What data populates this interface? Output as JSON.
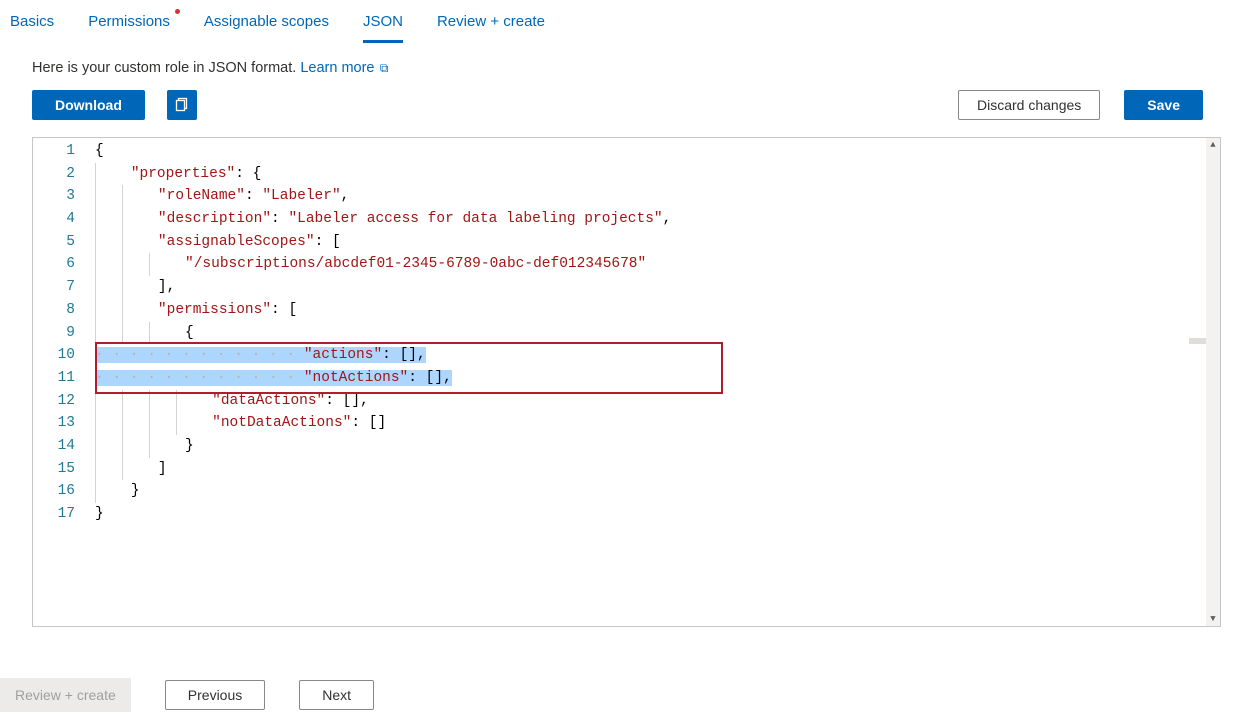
{
  "tabs": {
    "basics": "Basics",
    "permissions": "Permissions",
    "assignable_scopes": "Assignable scopes",
    "json": "JSON",
    "review_create": "Review + create"
  },
  "description": {
    "text": "Here is your custom role in JSON format. ",
    "link": "Learn more"
  },
  "actions": {
    "download": "Download",
    "discard": "Discard changes",
    "save": "Save"
  },
  "code": {
    "roleName_key": "\"roleName\"",
    "roleName_val": "\"Labeler\"",
    "description_key": "\"description\"",
    "description_val": "\"Labeler access for data labeling projects\"",
    "assignableScopes_key": "\"assignableScopes\"",
    "subscription_val": "\"/subscriptions/abcdef01-2345-6789-0abc-def012345678\"",
    "properties_key": "\"properties\"",
    "permissions_key": "\"permissions\"",
    "actions_key": "\"actions\"",
    "notActions_key": "\"notActions\"",
    "dataActions_key": "\"dataActions\"",
    "notDataActions_key": "\"notDataActions\""
  },
  "line_numbers": [
    "1",
    "2",
    "3",
    "4",
    "5",
    "6",
    "7",
    "8",
    "9",
    "10",
    "11",
    "12",
    "13",
    "14",
    "15",
    "16",
    "17"
  ],
  "footer": {
    "review_create": "Review + create",
    "previous": "Previous",
    "next": "Next"
  }
}
